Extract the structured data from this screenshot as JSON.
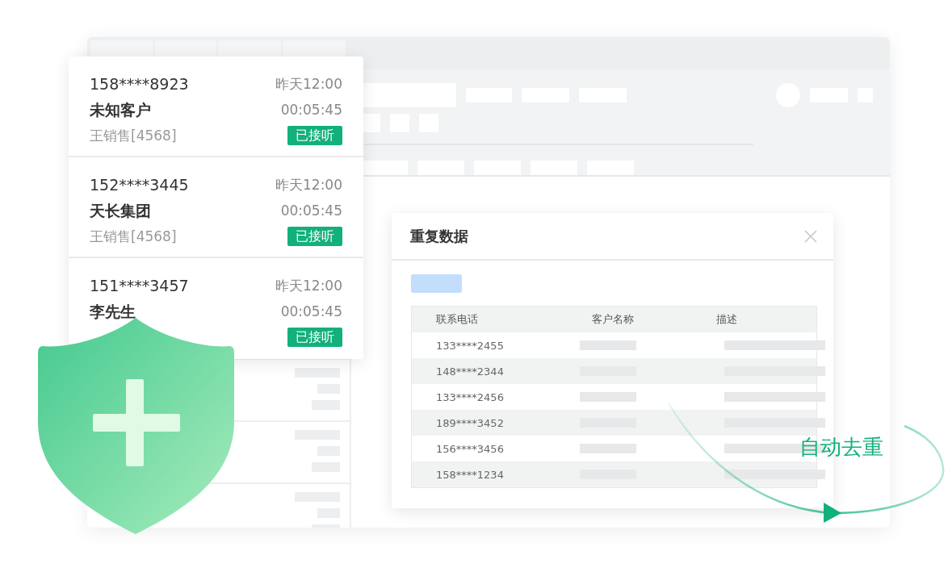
{
  "calls": [
    {
      "phone": "158****8923",
      "time": "昨天12:00",
      "customer": "未知客户",
      "duration": "00:05:45",
      "agent": "王销售[4568]",
      "status": "已接听"
    },
    {
      "phone": "152****3445",
      "time": "昨天12:00",
      "customer": "天长集团",
      "duration": "00:05:45",
      "agent": "王销售[4568]",
      "status": "已接听"
    },
    {
      "phone": "151****3457",
      "time": "昨天12:00",
      "customer": "李先生",
      "duration": "00:05:45",
      "status": "已接听"
    }
  ],
  "dialog": {
    "title": "重复数据",
    "columns": [
      "联系电话",
      "客户名称",
      "描述"
    ],
    "rows": [
      {
        "phone": "133****2455"
      },
      {
        "phone": "148****2344"
      },
      {
        "phone": "133****2456"
      },
      {
        "phone": "189****3452"
      },
      {
        "phone": "156****3456"
      },
      {
        "phone": "158****1234"
      }
    ]
  },
  "tag": "自动去重"
}
